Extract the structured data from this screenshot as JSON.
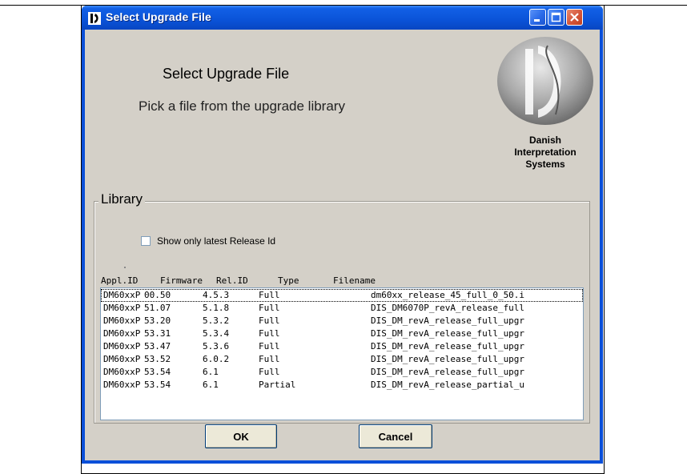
{
  "window": {
    "title": "Select Upgrade File"
  },
  "header": {
    "title": "Select Upgrade File",
    "subtitle": "Pick a file from the upgrade library",
    "logo_lines": [
      "Danish",
      "Interpretation",
      "Systems"
    ]
  },
  "library": {
    "group_label": "Library",
    "checkbox_label": "Show only latest Release Id",
    "checkbox_checked": false,
    "columns": [
      "Appl.ID",
      "Firmware",
      "Rel.ID",
      "Type",
      "Filename"
    ],
    "rows": [
      [
        "DM60xxP",
        "00.50",
        "4.5.3",
        "Full",
        "dm60xx_release_45_full_0_50.i"
      ],
      [
        "DM60xxP",
        "51.07",
        "5.1.8",
        "Full",
        "DIS_DM6070P_revA_release_full"
      ],
      [
        "DM60xxP",
        "53.20",
        "5.3.2",
        "Full",
        "DIS_DM_revA_release_full_upgr"
      ],
      [
        "DM60xxP",
        "53.31",
        "5.3.4",
        "Full",
        "DIS_DM_revA_release_full_upgr"
      ],
      [
        "DM60xxP",
        "53.47",
        "5.3.6",
        "Full",
        "DIS_DM_revA_release_full_upgr"
      ],
      [
        "DM60xxP",
        "53.52",
        "6.0.2",
        "Full",
        "DIS_DM_revA_release_full_upgr"
      ],
      [
        "DM60xxP",
        "53.54",
        "6.1",
        "Full",
        "DIS_DM_revA_release_full_upgr"
      ],
      [
        "DM60xxP",
        "53.54",
        "6.1",
        "Partial",
        "DIS_DM_revA_release_partial_u"
      ]
    ],
    "selected_row": 0
  },
  "buttons": {
    "ok": "OK",
    "cancel": "Cancel"
  },
  "icons": {
    "title_icon": "dis-logo-icon",
    "minimize": "minimize-icon",
    "maximize": "maximize-icon",
    "close": "close-icon"
  },
  "colors": {
    "titlebar": "#0a53d8",
    "dialog_bg": "#d4d0c8",
    "close_button": "#d4553a"
  }
}
